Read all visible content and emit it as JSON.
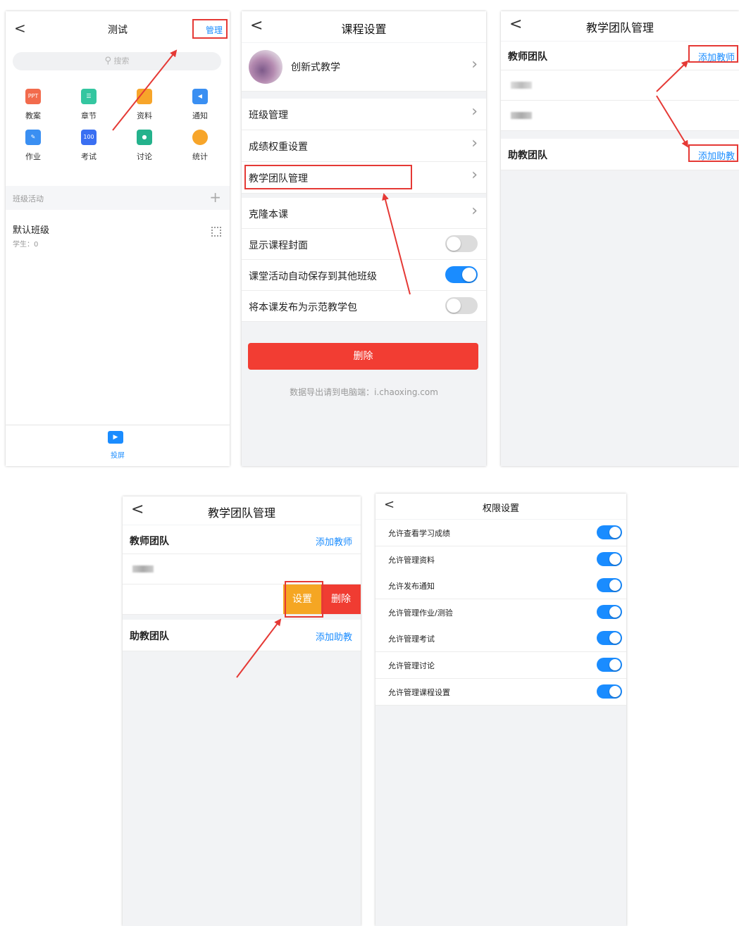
{
  "colors": {
    "accent": "#1a8cff",
    "danger": "#f03c32",
    "orange": "#f5a623",
    "annotation": "#e53935"
  },
  "panel1": {
    "back": "<",
    "title": "测试",
    "manage": "管理",
    "search_placeholder": "搜索",
    "icons": [
      {
        "label": "教案",
        "icon": "ppt-icon",
        "color": "#f26b4d",
        "glyph": "PPT"
      },
      {
        "label": "章节",
        "icon": "chapter-icon",
        "color": "#34c6a0",
        "glyph": "☰"
      },
      {
        "label": "资料",
        "icon": "folder-icon",
        "color": "#f7a52a",
        "glyph": ""
      },
      {
        "label": "通知",
        "icon": "speaker-icon",
        "color": "#3a8ff2",
        "glyph": "◀"
      },
      {
        "label": "作业",
        "icon": "homework-icon",
        "color": "#3a8ff2",
        "glyph": "✎"
      },
      {
        "label": "考试",
        "icon": "exam-icon",
        "color": "#3a6ff2",
        "glyph": "100"
      },
      {
        "label": "讨论",
        "icon": "chat-icon",
        "color": "#24b28c",
        "glyph": "●"
      },
      {
        "label": "统计",
        "icon": "pie-chart-icon",
        "color": "#f7a52a",
        "glyph": ""
      }
    ],
    "section_title": "班级活动",
    "section_add": "+",
    "class_name": "默认班级",
    "class_students": "学生：0",
    "bottom_label": "投屏"
  },
  "panel2": {
    "back": "<",
    "title": "课程设置",
    "course_name": "创新式教学",
    "rows_a": [
      "班级管理",
      "成绩权重设置",
      "教学团队管理"
    ],
    "rows_b": [
      {
        "label": "克隆本课",
        "type": "chevron"
      },
      {
        "label": "显示课程封面",
        "type": "toggle",
        "on": false
      },
      {
        "label": "课堂活动自动保存到其他班级",
        "type": "toggle",
        "on": true
      },
      {
        "label": "将本课发布为示范教学包",
        "type": "toggle",
        "on": false
      }
    ],
    "delete_label": "删除",
    "footer": "数据导出请到电脑端：i.chaoxing.com"
  },
  "panel3": {
    "back": "<",
    "title": "教学团队管理",
    "teacher_section": "教师团队",
    "add_teacher": "添加教师",
    "assistant_section": "助教团队",
    "add_assistant": "添加助教"
  },
  "panel4": {
    "back": "<",
    "title": "教学团队管理",
    "teacher_section": "教师团队",
    "add_teacher": "添加教师",
    "settings_label": "设置",
    "delete_label": "删除",
    "assistant_section": "助教团队",
    "add_assistant": "添加助教"
  },
  "panel5": {
    "back": "<",
    "title": "权限设置",
    "permissions": [
      {
        "label": "允许查看学习成绩",
        "on": true
      },
      {
        "label": "允许管理资料",
        "on": true
      },
      {
        "label": "允许发布通知",
        "on": true
      },
      {
        "label": "允许管理作业/测验",
        "on": true
      },
      {
        "label": "允许管理考试",
        "on": true
      },
      {
        "label": "允许管理讨论",
        "on": true
      },
      {
        "label": "允许管理课程设置",
        "on": true
      }
    ]
  }
}
